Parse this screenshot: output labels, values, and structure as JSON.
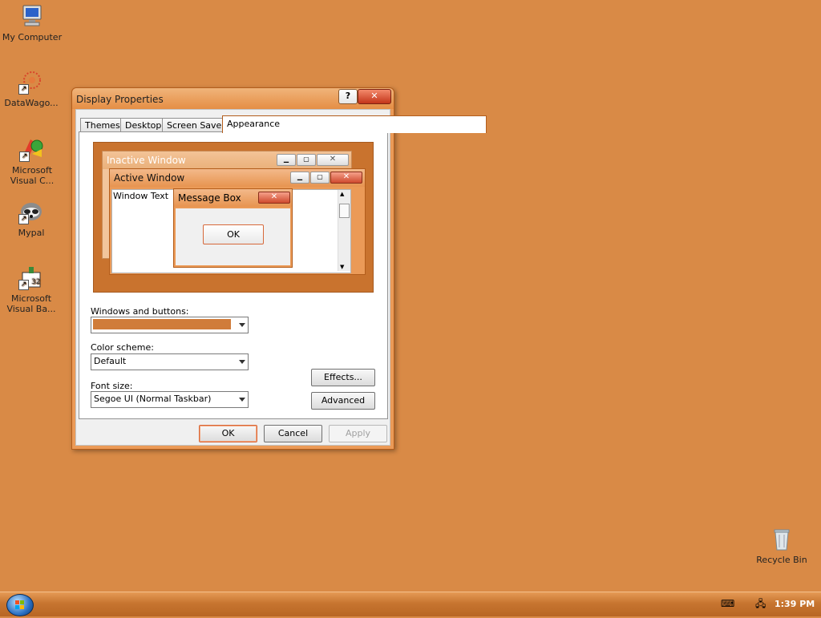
{
  "desktop": {
    "icons": [
      {
        "label": "My Computer",
        "icon": "computer-icon"
      },
      {
        "label": "DataWago...",
        "icon": "datawagon-icon"
      },
      {
        "label": "Microsoft Visual C...",
        "icon": "visual-c-icon"
      },
      {
        "label": "Mypal",
        "icon": "mypal-icon"
      },
      {
        "label": "Microsoft Visual Ba...",
        "icon": "visual-basic-icon"
      },
      {
        "label": "Recycle Bin",
        "icon": "recycle-bin-icon"
      }
    ]
  },
  "window": {
    "title": "Display Properties",
    "help_glyph": "?",
    "close_glyph": "✕",
    "tabs": [
      {
        "label": "Themes"
      },
      {
        "label": "Desktop"
      },
      {
        "label": "Screen Saver"
      },
      {
        "label": "Appearance"
      }
    ],
    "preview": {
      "inactive_title": "Inactive Window",
      "active_title": "Active Window",
      "window_text": "Window Text",
      "message_title": "Message Box",
      "message_ok": "OK"
    },
    "fields": {
      "windows_buttons_label": "Windows and buttons:",
      "color_scheme_label": "Color scheme:",
      "color_scheme_value": "Default",
      "font_size_label": "Font size:",
      "font_size_value": "Segoe UI (Normal Taskbar)"
    },
    "buttons": {
      "effects": "Effects...",
      "advanced": "Advanced",
      "ok": "OK",
      "cancel": "Cancel",
      "apply": "Apply"
    }
  },
  "taskbar": {
    "clock": "1:39 PM"
  },
  "colors": {
    "desktop": "#d98a46",
    "window_frame": "#eb9a57",
    "scheme_swatch": "#d07c3a"
  }
}
